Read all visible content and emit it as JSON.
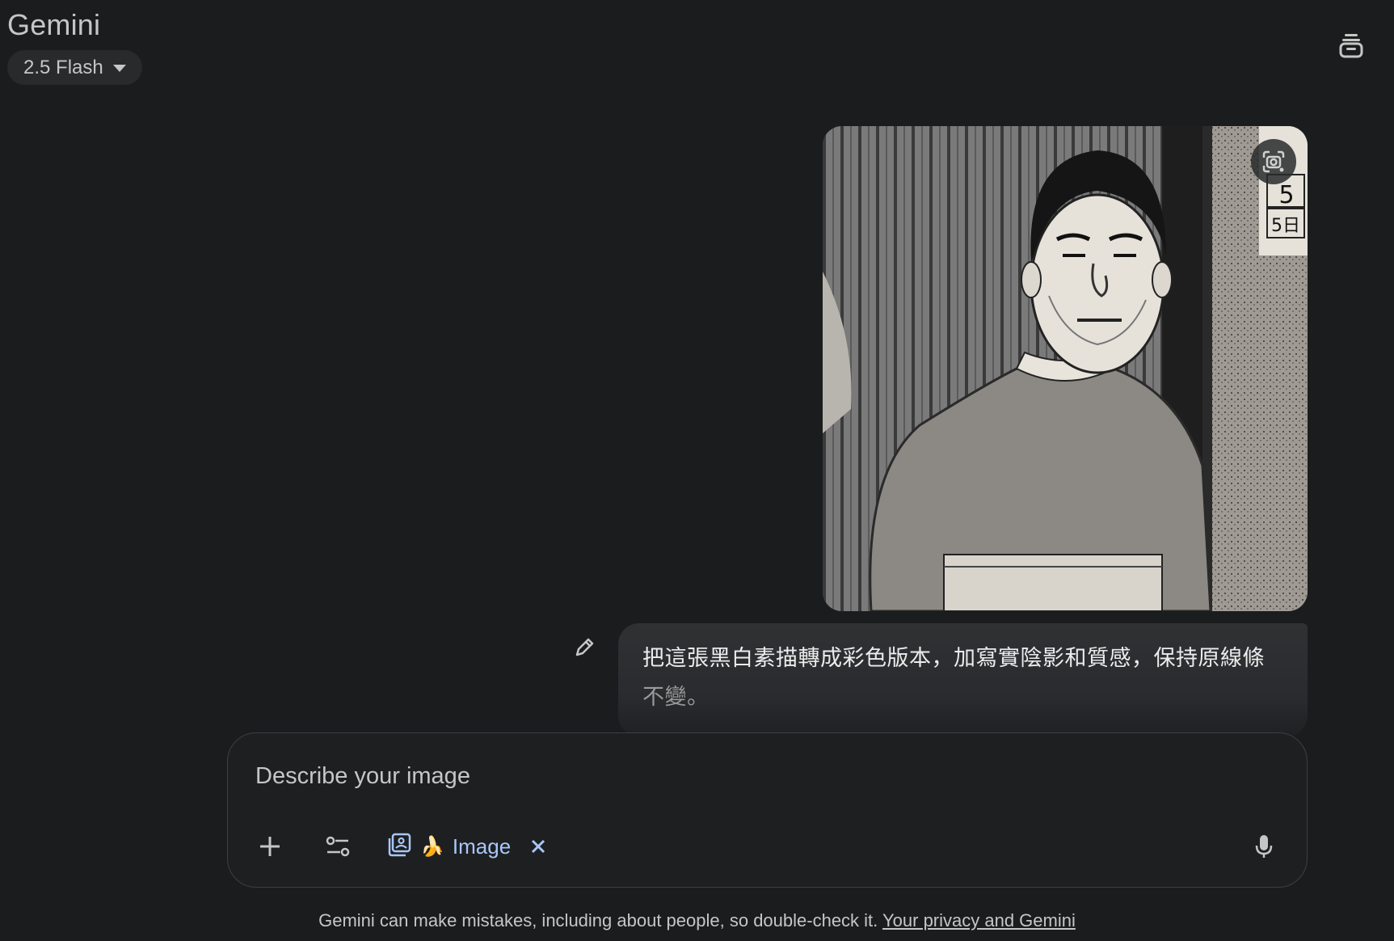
{
  "header": {
    "brand": "Gemini",
    "model_label": "2.5 Flash",
    "top_right_icon": "stacked-chats-icon"
  },
  "conversation": {
    "image_message": {
      "alt": "Black and white manga-style sketch of a stern heavy-set man in a sweater standing in a doorway",
      "sign_digits": [
        "5",
        "5日"
      ],
      "lens_icon": "google-lens-icon"
    },
    "text_message": {
      "line1": "把這張黑白素描轉成彩色版本，加寫實陰影和質感，保持原線條",
      "line2": "不變。",
      "edit_icon": "pencil-icon"
    }
  },
  "composer": {
    "placeholder": "Describe your image",
    "value": "",
    "tool_chip_label": "Image",
    "tool_chip_emoji": "🍌",
    "icons": {
      "add": "plus-icon",
      "tools": "tools-sliders-icon",
      "image_tool": "image-generate-icon",
      "close": "close-icon",
      "mic": "microphone-icon"
    }
  },
  "footer": {
    "disclaimer": "Gemini can make mistakes, including about people, so double-check it. ",
    "privacy_link": "Your privacy and Gemini"
  },
  "colors": {
    "background": "#1b1c1d",
    "bubble": "#2a2b2e",
    "accent": "#a8c7fa",
    "text": "#e3e3e3"
  }
}
